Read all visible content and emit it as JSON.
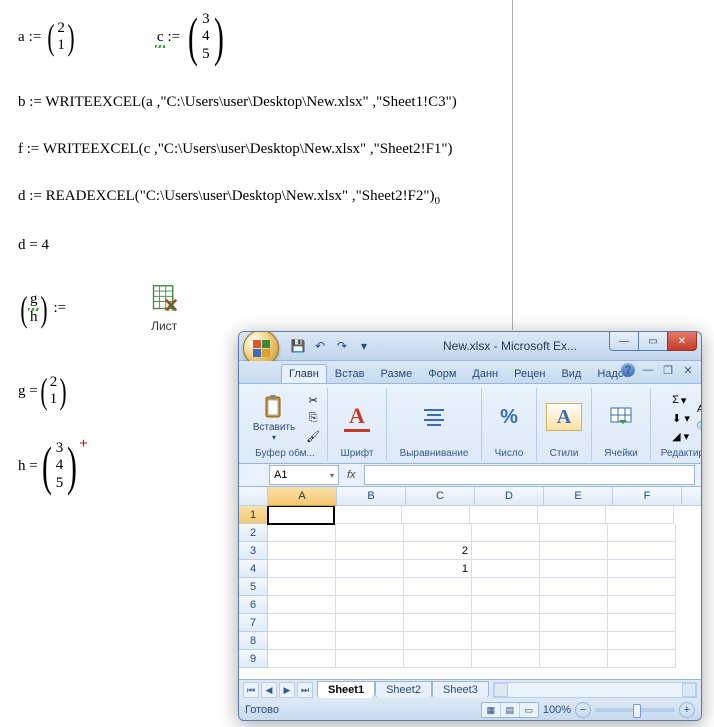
{
  "mathcad": {
    "a_def": {
      "lhs": "a",
      "op": ":=",
      "col": [
        "2",
        "1"
      ]
    },
    "c_def": {
      "lhs": "c",
      "op": ":=",
      "col": [
        "3",
        "4",
        "5"
      ],
      "squiggle": true
    },
    "b_expr": "b := WRITEEXCEL(a ,\"C:\\Users\\user\\Desktop\\New.xlsx\" ,\"Sheet1!C3\")",
    "f_expr": "f := WRITEEXCEL(c ,\"C:\\Users\\user\\Desktop\\New.xlsx\" ,\"Sheet2!F1\")",
    "d_expr_main": "d := READEXCEL(\"C:\\Users\\user\\Desktop\\New.xlsx\" ,\"Sheet2!F2\")",
    "d_sub": "0",
    "d_result": "d = 4",
    "gh_def": {
      "col": [
        "g",
        "h"
      ],
      "op": ":=",
      "g_squiggle": true
    },
    "sheet_icon_label": "Лист",
    "g_result": {
      "lhs": "g =",
      "col": [
        "2",
        "1"
      ]
    },
    "h_result": {
      "lhs": "h =",
      "col": [
        "3",
        "4",
        "5"
      ],
      "cross": "+"
    }
  },
  "excel": {
    "title": "New.xlsx - Microsoft Ex...",
    "qat": {
      "save": "💾",
      "undo": "↶",
      "redo": "↷"
    },
    "tabs": [
      "Главн",
      "Встав",
      "Разме",
      "Форм",
      "Данн",
      "Рецен",
      "Вид",
      "Надст"
    ],
    "active_tab": 0,
    "help": "?",
    "ribbon": {
      "clipboard": {
        "label": "Буфер обм...",
        "paste": "Вставить"
      },
      "font": {
        "label": "Шрифт",
        "letter": "A"
      },
      "align": {
        "label": "Выравнивание"
      },
      "number": {
        "label": "Число",
        "pct": "%"
      },
      "styles": {
        "label": "Стили",
        "letter": "A"
      },
      "cells": {
        "label": "Ячейки"
      },
      "editing": {
        "label": "Редактиров...",
        "sigma": "Σ",
        "az": "A▾"
      }
    },
    "namebox": "A1",
    "fx": "fx",
    "columns": [
      "A",
      "B",
      "C",
      "D",
      "E",
      "F"
    ],
    "rows": [
      "1",
      "2",
      "3",
      "4",
      "5",
      "6",
      "7",
      "8",
      "9"
    ],
    "cells": {
      "C3": "2",
      "C4": "1"
    },
    "sheet_tabs": [
      "Sheet1",
      "Sheet2",
      "Sheet3"
    ],
    "active_sheet": 0,
    "status": "Готово",
    "zoom": "100%",
    "zoom_minus": "−",
    "zoom_plus": "+"
  }
}
